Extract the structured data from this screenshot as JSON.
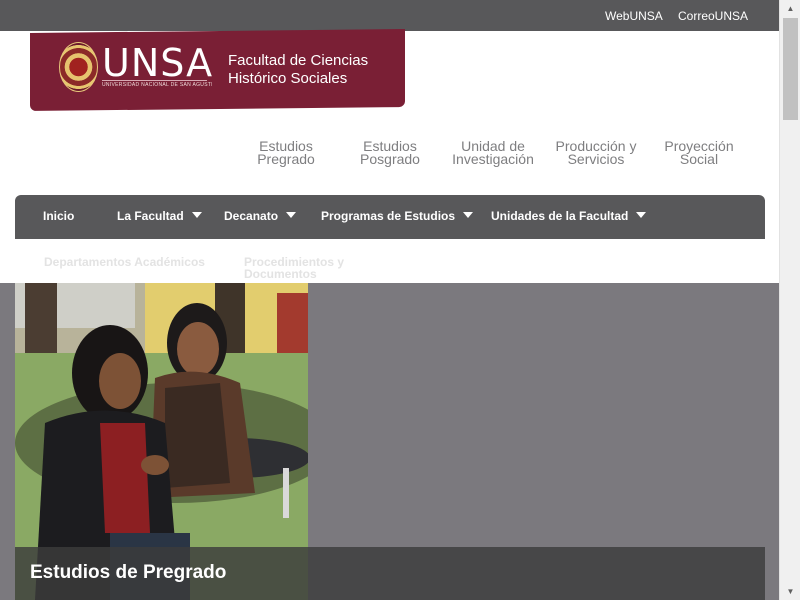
{
  "topbar": {
    "links": [
      "WebUNSA",
      "CorreoUNSA"
    ]
  },
  "header": {
    "logo_text": "UNSA",
    "logo_subtext": "UNIVERSIDAD NACIONAL DE SAN AGUSTÍN DE AREQUIPA",
    "faculty_line1": "Facultad de Ciencias",
    "faculty_line2": "Histórico Sociales"
  },
  "secondary_nav": [
    {
      "line1": "Estudios",
      "line2": "Pregrado"
    },
    {
      "line1": "Estudios",
      "line2": "Posgrado"
    },
    {
      "line1": "Unidad de",
      "line2": "Investigación"
    },
    {
      "line1": "Producción y",
      "line2": "Servicios"
    },
    {
      "line1": "Proyección",
      "line2": "Social"
    }
  ],
  "main_nav": {
    "items": [
      "Inicio",
      "La Facultad",
      "Decanato",
      "Programas de Estudios",
      "Unidades de la Facultad"
    ]
  },
  "dropdown_strip": {
    "items": [
      {
        "line1": "Departamentos Académicos",
        "line2": ""
      },
      {
        "line1": "Procedimientos y",
        "line2": "Documentos"
      }
    ]
  },
  "hero": {
    "caption": "Estudios de Pregrado"
  },
  "colors": {
    "brand": "#7a1f35",
    "nav_bg": "#58585a",
    "hero_bg": "#7b797e"
  }
}
